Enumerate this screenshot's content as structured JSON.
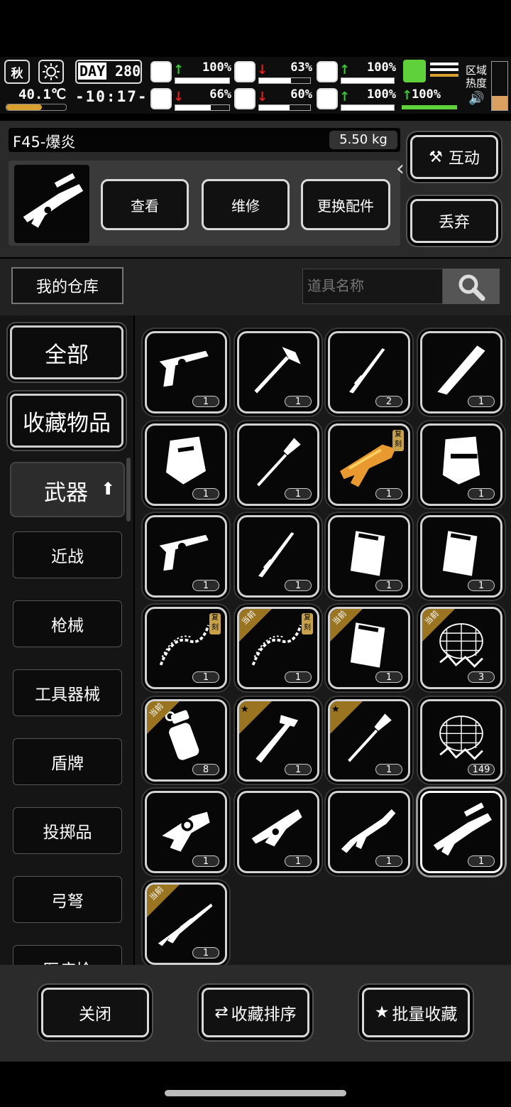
{
  "hud": {
    "season": "秋",
    "day_label": "DAY",
    "day_value": "280",
    "temperature": "40.1℃",
    "clock": "-10:17-",
    "stats": [
      {
        "name": "health",
        "arrow": "up",
        "value": "100%",
        "level": 1.0
      },
      {
        "name": "hunger",
        "arrow": "down",
        "value": "63%",
        "level": 0.63
      },
      {
        "name": "energy",
        "arrow": "up",
        "value": "100%",
        "level": 1.0
      },
      {
        "name": "mind",
        "arrow": "down",
        "value": "66%",
        "level": 0.66
      },
      {
        "name": "thirst",
        "arrow": "down",
        "value": "60%",
        "level": 0.6
      },
      {
        "name": "mood",
        "arrow": "up",
        "value": "100%",
        "level": 1.0
      }
    ],
    "stamina_value": "100%",
    "zone_heat_label": "区域\n热度"
  },
  "item": {
    "name": "F45-爆炎",
    "weight": "5.50 kg",
    "actions": [
      "查看",
      "维修",
      "更换配件"
    ],
    "interact_label": "互动",
    "discard_label": "丢弃"
  },
  "storage": {
    "title": "我的仓库",
    "search_placeholder": "道具名称"
  },
  "sidebar": {
    "all": "全部",
    "favorites": "收藏物品",
    "weapons": "武器",
    "subs": [
      "近战",
      "枪械",
      "工具器械",
      "盾牌",
      "投掷品",
      "弓弩",
      "医疗枪"
    ]
  },
  "tags": {
    "current": "当前",
    "copy": "复刻"
  },
  "grid": [
    {
      "icon": "revolver-icon",
      "count": "1"
    },
    {
      "icon": "fire-axe-icon",
      "count": "1"
    },
    {
      "icon": "katana-icon",
      "count": "2"
    },
    {
      "icon": "machete-icon",
      "count": "1"
    },
    {
      "icon": "riot-shield-icon",
      "count": "1"
    },
    {
      "icon": "shovel-icon",
      "count": "1"
    },
    {
      "icon": "golden-blaster-icon",
      "count": "1",
      "copy": true
    },
    {
      "icon": "police-shield-icon",
      "count": "1"
    },
    {
      "icon": "revolver-icon",
      "count": "1"
    },
    {
      "icon": "katana-icon",
      "count": "1"
    },
    {
      "icon": "cargo-shield-icon",
      "count": "1"
    },
    {
      "icon": "cargo-shield-icon",
      "count": "1"
    },
    {
      "icon": "chain-whip-icon",
      "count": "1",
      "copy": true
    },
    {
      "icon": "chain-whip-icon",
      "count": "1",
      "copy": true,
      "current": true
    },
    {
      "icon": "cargo-shield-icon",
      "count": "1",
      "current": true
    },
    {
      "icon": "net-trap-icon",
      "count": "3",
      "current": true
    },
    {
      "icon": "grenade-icon",
      "count": "8",
      "current": true
    },
    {
      "icon": "hammer-knife-icon",
      "count": "1",
      "starred": true
    },
    {
      "icon": "shovel-icon",
      "count": "1",
      "starred": true
    },
    {
      "icon": "net-trap-icon",
      "count": "149"
    },
    {
      "icon": "foam-gun-icon",
      "count": "1"
    },
    {
      "icon": "flame-pistol-icon",
      "count": "1"
    },
    {
      "icon": "assault-rifle-icon",
      "count": "1"
    },
    {
      "icon": "f45-launcher-icon",
      "count": "1",
      "selected": true
    },
    {
      "icon": "sniper-rifle-icon",
      "count": "1",
      "current": true
    }
  ],
  "bottom": {
    "close_label": "关闭",
    "sort_label": "收藏排序",
    "batch_label": "批量收藏"
  },
  "colors": {
    "accent_gold": "#9a7420",
    "up_arrow": "#37c837",
    "down_arrow": "#e02020",
    "stamina": "#5fd13b"
  }
}
